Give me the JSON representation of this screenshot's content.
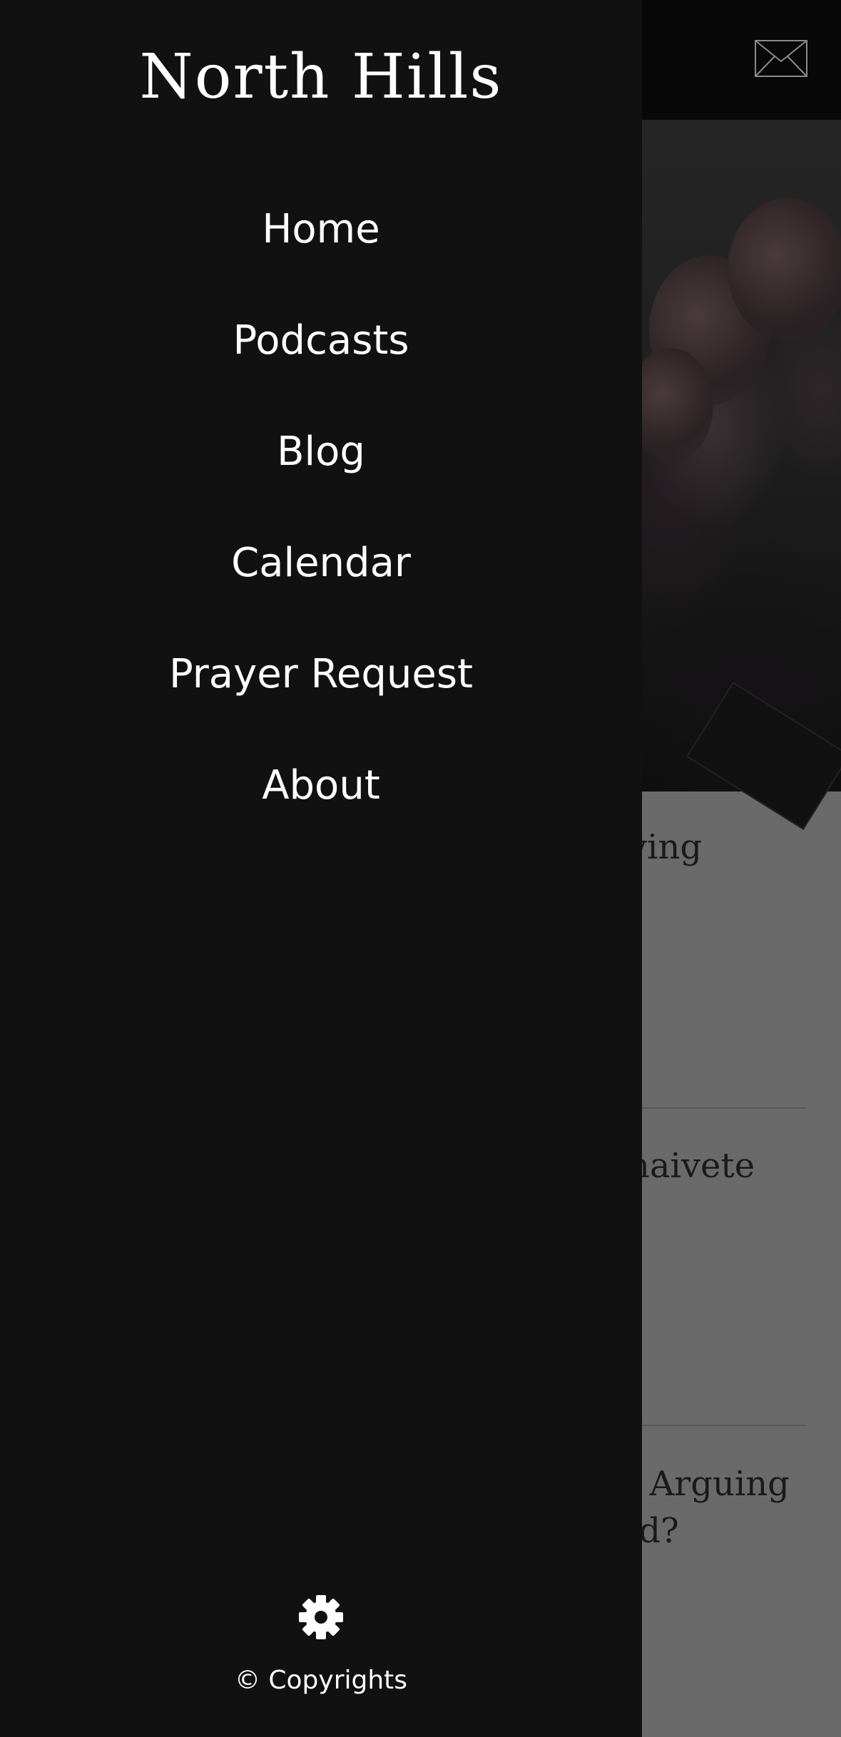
{
  "header": {
    "mail_icon": "mail-icon"
  },
  "drawer": {
    "brand": "North Hills",
    "nav_items": [
      {
        "label": "Home"
      },
      {
        "label": "Podcasts"
      },
      {
        "label": "Blog"
      },
      {
        "label": "Calendar"
      },
      {
        "label": "Prayer Request"
      },
      {
        "label": "About"
      }
    ],
    "settings_icon": "gear-icon",
    "copyright": "© Copyrights"
  },
  "background_posts": [
    {
      "visible_title": "ving"
    },
    {
      "visible_title": "naivete"
    },
    {
      "visible_title": "ı Arguing\nld?"
    }
  ],
  "colors": {
    "drawer_bg": "#111111",
    "header_bg": "#080808",
    "content_bg": "#6a6a6a",
    "text": "#ffffff"
  }
}
